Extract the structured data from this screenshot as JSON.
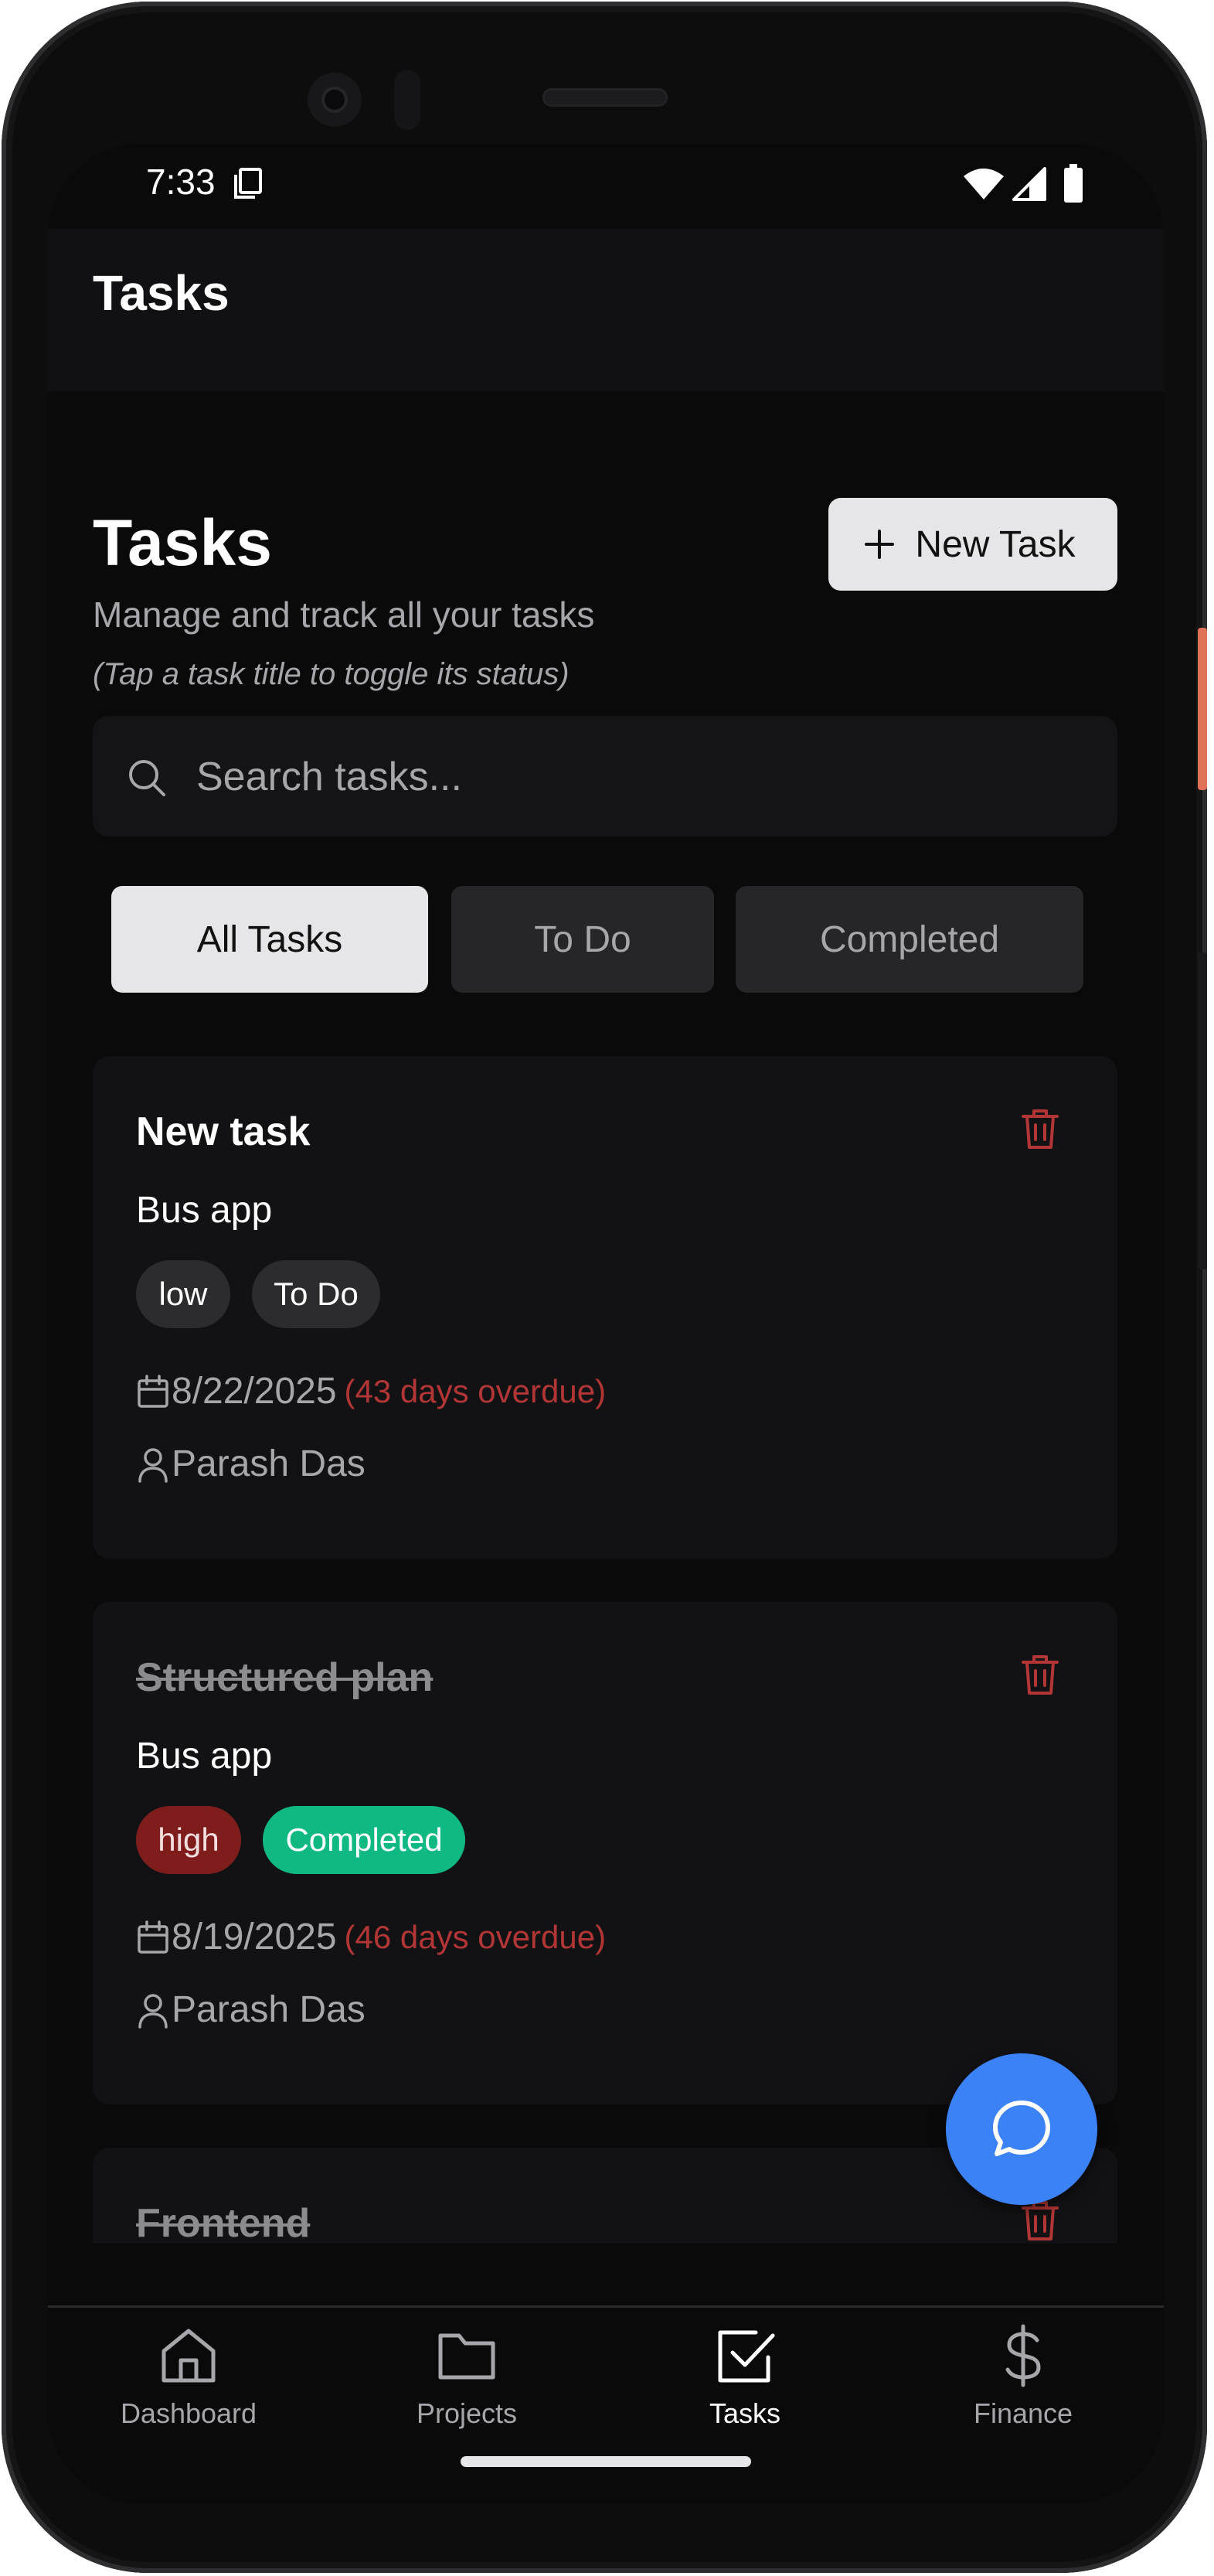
{
  "status_bar": {
    "time": "7:33"
  },
  "app_bar": {
    "title": "Tasks"
  },
  "header": {
    "title": "Tasks",
    "subtitle": "Manage and track all your tasks",
    "hint": "(Tap a task title to toggle its status)",
    "new_task_label": "New Task"
  },
  "search": {
    "placeholder": "Search tasks..."
  },
  "filters": [
    {
      "label": "All Tasks",
      "active": true
    },
    {
      "label": "To Do",
      "active": false
    },
    {
      "label": "Completed",
      "active": false
    }
  ],
  "tasks": [
    {
      "title": "New task",
      "completed": false,
      "project": "Bus app",
      "priority": "low",
      "status": "To Do",
      "due_date": "8/22/2025",
      "overdue": "(43 days overdue)",
      "assignee": "Parash Das"
    },
    {
      "title": "Structured plan",
      "completed": true,
      "project": "Bus app",
      "priority": "high",
      "status": "Completed",
      "due_date": "8/19/2025",
      "overdue": "(46 days overdue)",
      "assignee": "Parash Das"
    },
    {
      "title": "Frontend",
      "completed": true
    }
  ],
  "bottom_nav": [
    {
      "label": "Dashboard",
      "icon": "home-icon",
      "active": false
    },
    {
      "label": "Projects",
      "icon": "folder-icon",
      "active": false
    },
    {
      "label": "Tasks",
      "icon": "check-square-icon",
      "active": true
    },
    {
      "label": "Finance",
      "icon": "dollar-icon",
      "active": false
    }
  ],
  "colors": {
    "background": "#0a0a0b",
    "card": "#121214",
    "accent_fab": "#3b82f6",
    "overdue": "#b23636",
    "completed_badge": "#10b981",
    "high_badge": "#7f1d1d"
  }
}
